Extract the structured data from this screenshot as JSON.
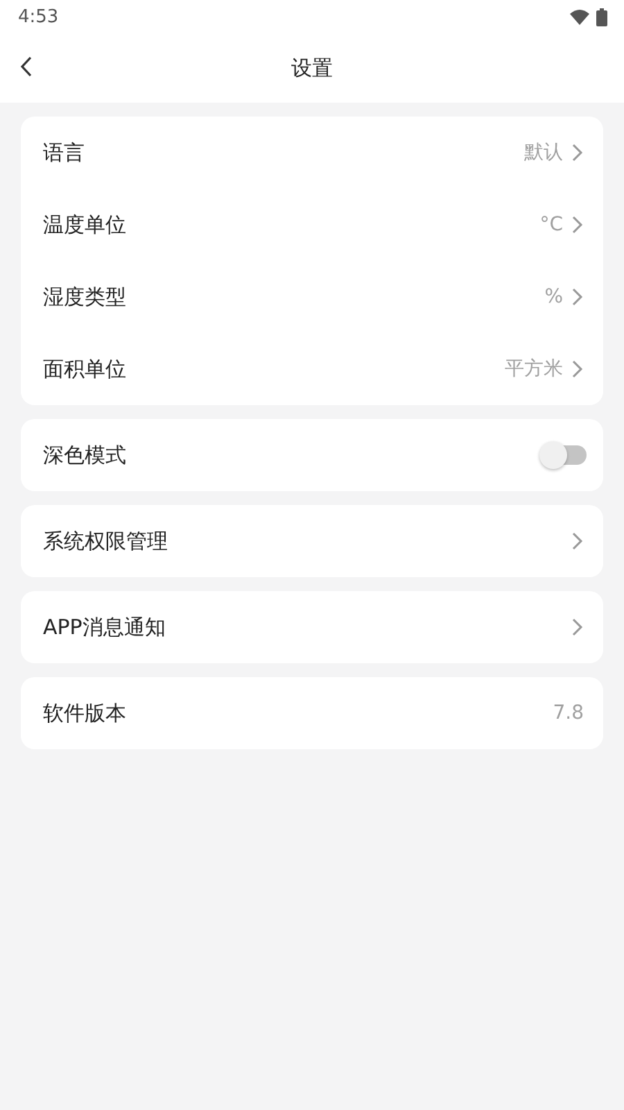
{
  "status_bar": {
    "time": "4:53"
  },
  "header": {
    "title": "设置"
  },
  "groups": [
    {
      "rows": [
        {
          "kind": "link",
          "label": "语言",
          "value": "默认"
        },
        {
          "kind": "link",
          "label": "温度单位",
          "value": "°C"
        },
        {
          "kind": "link",
          "label": "湿度类型",
          "value": "%"
        },
        {
          "kind": "link",
          "label": "面积单位",
          "value": "平方米"
        }
      ]
    },
    {
      "rows": [
        {
          "kind": "toggle",
          "label": "深色模式",
          "on": false
        }
      ]
    },
    {
      "rows": [
        {
          "kind": "link",
          "label": "系统权限管理"
        }
      ]
    },
    {
      "rows": [
        {
          "kind": "link",
          "label": "APP消息通知"
        }
      ]
    },
    {
      "rows": [
        {
          "kind": "info",
          "label": "软件版本",
          "value": "7.8"
        }
      ]
    }
  ]
}
